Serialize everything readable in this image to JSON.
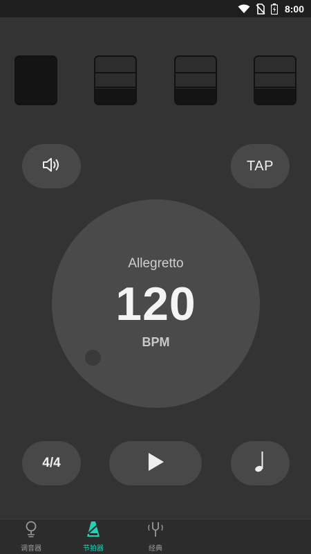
{
  "status_bar": {
    "time": "8:00",
    "icons": [
      "wifi-icon",
      "no-sim-icon",
      "battery-icon"
    ]
  },
  "beats": [
    {
      "type": "accent"
    },
    {
      "type": "normal"
    },
    {
      "type": "normal"
    },
    {
      "type": "normal"
    }
  ],
  "controls": {
    "sound_icon": "speaker-icon",
    "tap_label": "TAP",
    "time_signature": "4/4",
    "play_icon": "play-icon",
    "note_icon": "quarter-note-icon"
  },
  "tempo": {
    "marking": "Allegretto",
    "bpm": "120",
    "unit": "BPM"
  },
  "nav": {
    "items": [
      {
        "label": "调音器",
        "icon": "tuner-icon",
        "active": false
      },
      {
        "label": "节拍器",
        "icon": "metronome-icon",
        "active": true
      },
      {
        "label": "经典",
        "icon": "tuning-fork-icon",
        "active": false
      }
    ]
  },
  "colors": {
    "background": "#333333",
    "button": "#484848",
    "dial": "#4a4a4a",
    "accent": "#1fd3b7"
  }
}
